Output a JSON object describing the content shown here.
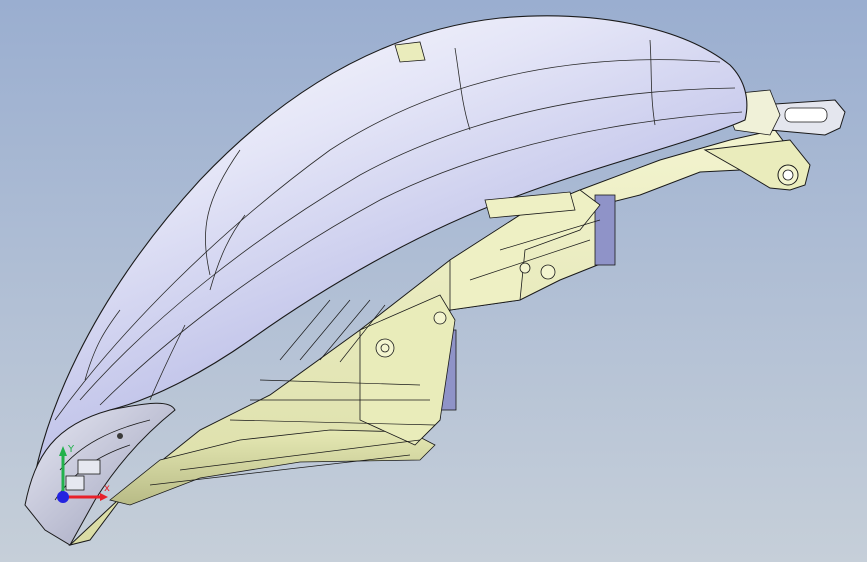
{
  "viewport": {
    "background_top": "#9aaed0",
    "background_bottom": "#c6cfd9",
    "model_lens_color": "#d8d9f2",
    "model_housing_color": "#ecefc0",
    "edge_color": "#1a1a1a"
  },
  "triad": {
    "x_axis_color": "#e8202a",
    "y_axis_color": "#22b14c",
    "z_axis_color": "#2424e0",
    "x_label": "x",
    "y_label": "Y"
  }
}
